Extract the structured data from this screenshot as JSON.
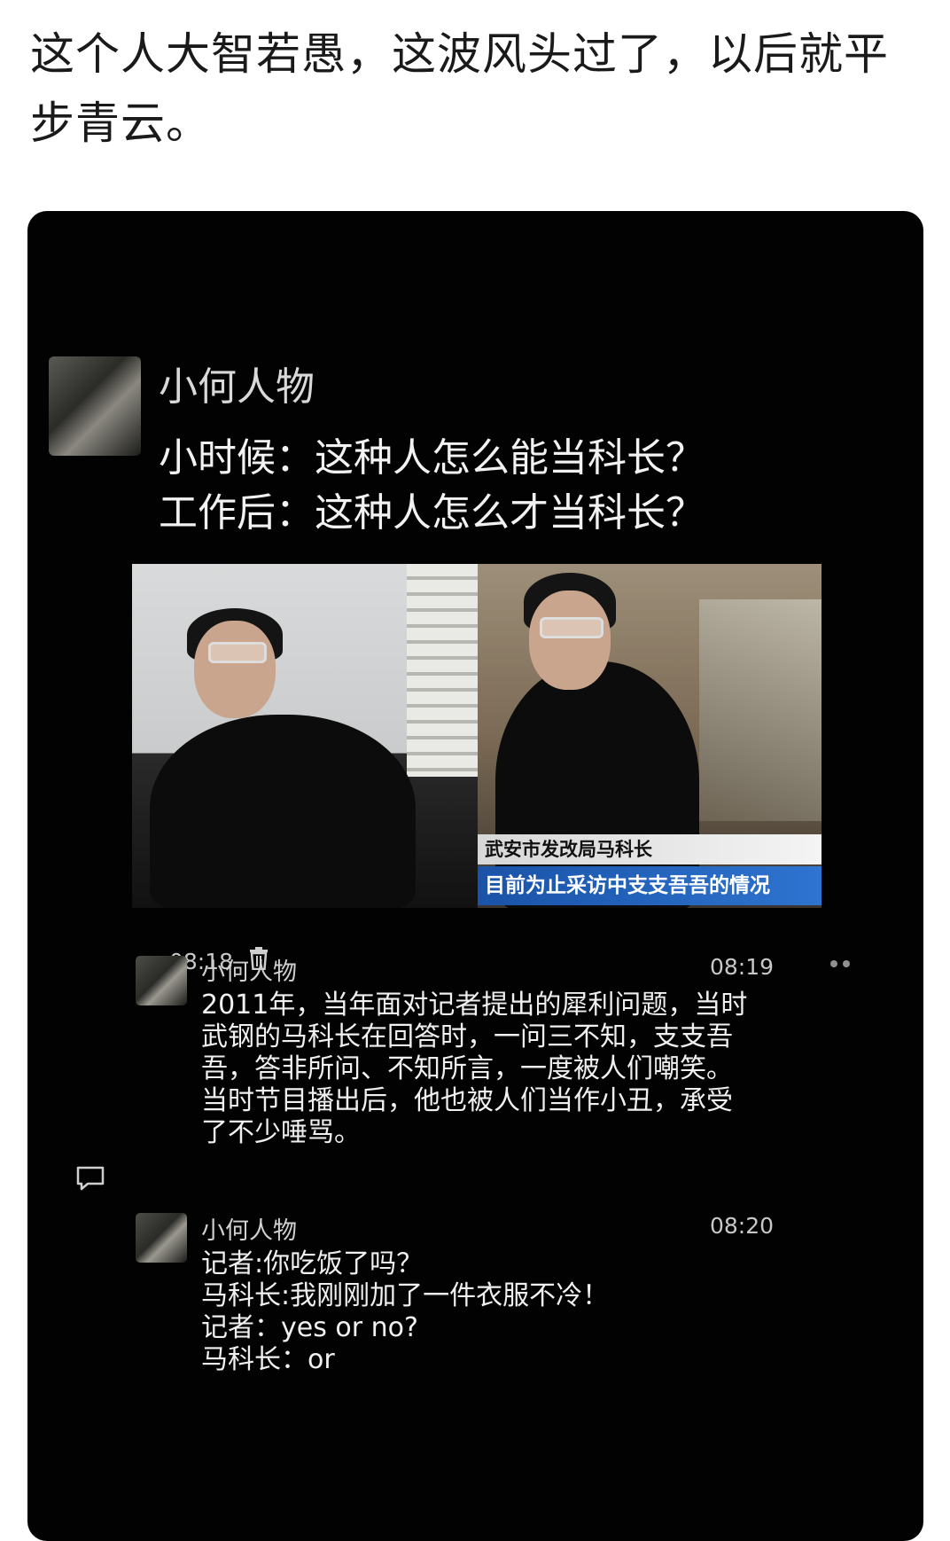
{
  "post": {
    "caption": "这个人大智若愚，这波风头过了，以后就平步青云。"
  },
  "card": {
    "author": "小何人物",
    "line1": "小时候：这种人怎么能当科长？",
    "line2": "工作后：这种人怎么才当科长？",
    "media": {
      "news_title": "武安市发改局马科长",
      "news_subtitle": "目前为止采访中支支吾吾的情况"
    },
    "time": "08:18",
    "icons": {
      "delete": "trash-icon",
      "more": "more-icon",
      "comment": "comment-icon"
    }
  },
  "comments": [
    {
      "author": "小何人物",
      "time": "08:19",
      "text": "2011年，当年面对记者提出的犀利问题，当时武钢的马科长在回答时，一问三不知，支支吾吾，答非所问、不知所言，一度被人们嘲笑。\n当时节目播出后，他也被人们当作小丑，承受了不少唾骂。"
    },
    {
      "author": "小何人物",
      "time": "08:20",
      "text": "记者:你吃饭了吗？\n马科长:我刚刚加了一件衣服不冷！\n记者：yes or no?\n马科长：or"
    }
  ]
}
